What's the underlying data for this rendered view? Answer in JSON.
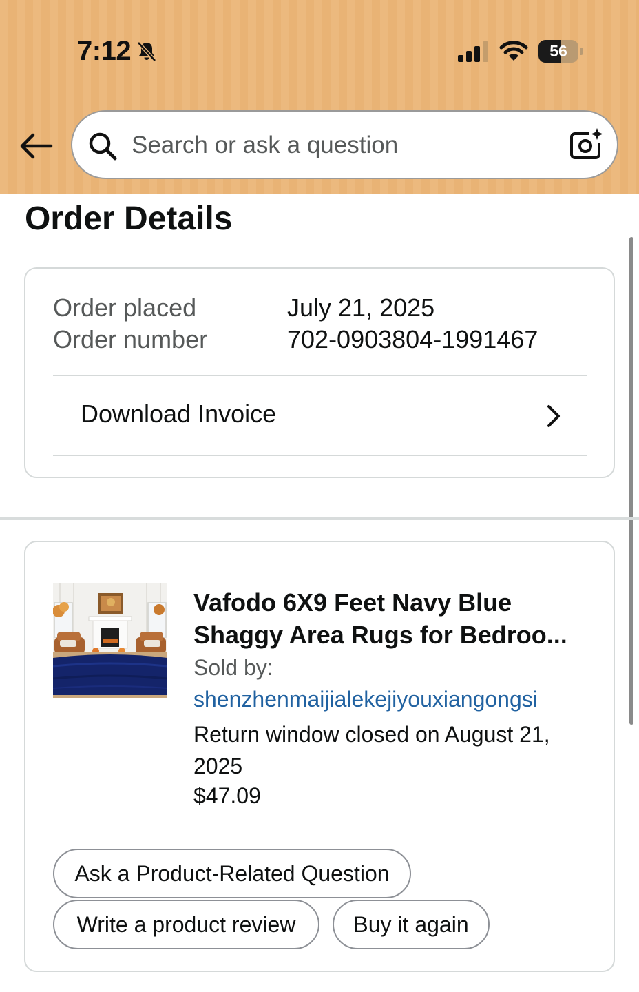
{
  "status_bar": {
    "time": "7:12",
    "battery": "56",
    "battery_fraction": 0.56,
    "icons": [
      "bell-slash-icon",
      "cellular-signal-icon",
      "wifi-icon",
      "battery-icon"
    ]
  },
  "header": {
    "back_icon": "arrow-left-icon",
    "search": {
      "placeholder": "Search or ask a question",
      "icon": "search-icon"
    },
    "camera_icon": "camera-sparkle-icon",
    "background_color": "#ecb97e"
  },
  "page": {
    "title": "Order Details"
  },
  "order_summary": {
    "placed_label": "Order placed",
    "placed_value": "July 21, 2025",
    "number_label": "Order number",
    "number_value": "702-0903804-1991467",
    "invoice_label": "Download Invoice",
    "invoice_icon": "chevron-right-icon"
  },
  "item": {
    "title": "Vafodo 6X9 Feet Navy Blue Shaggy Area Rugs for Bedroo...",
    "sold_by_label": "Sold by:",
    "seller": "shenzhenmaijialekejiyouxiangongsi",
    "return_note": "Return window closed on August 21, 2025",
    "price": "$47.09",
    "image": "navy-rug-living-room-image",
    "link_color": "#2162a1"
  },
  "actions": {
    "ask_question": "Ask a Product-Related Question",
    "write_review": "Write a product review",
    "buy_again": "Buy it again"
  }
}
